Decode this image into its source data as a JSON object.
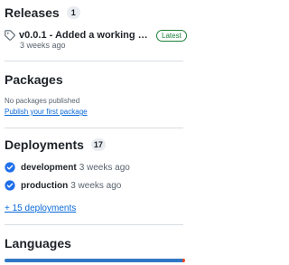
{
  "releases": {
    "title": "Releases",
    "count": "1",
    "item": {
      "name": "v0.0.1 - Added a working versio...",
      "badge": "Latest",
      "date": "3 weeks ago"
    }
  },
  "packages": {
    "title": "Packages",
    "empty_text": "No packages published",
    "link": "Publish your first package"
  },
  "deployments": {
    "title": "Deployments",
    "count": "17",
    "items": [
      {
        "name": "development",
        "time": "3 weeks ago",
        "status_color": "#1f6feb"
      },
      {
        "name": "production",
        "time": "3 weeks ago",
        "status_color": "#1f6feb"
      }
    ],
    "more": "+ 15 deployments"
  },
  "languages": {
    "title": "Languages",
    "colors": [
      "#3178c6",
      "#e34c26"
    ]
  }
}
